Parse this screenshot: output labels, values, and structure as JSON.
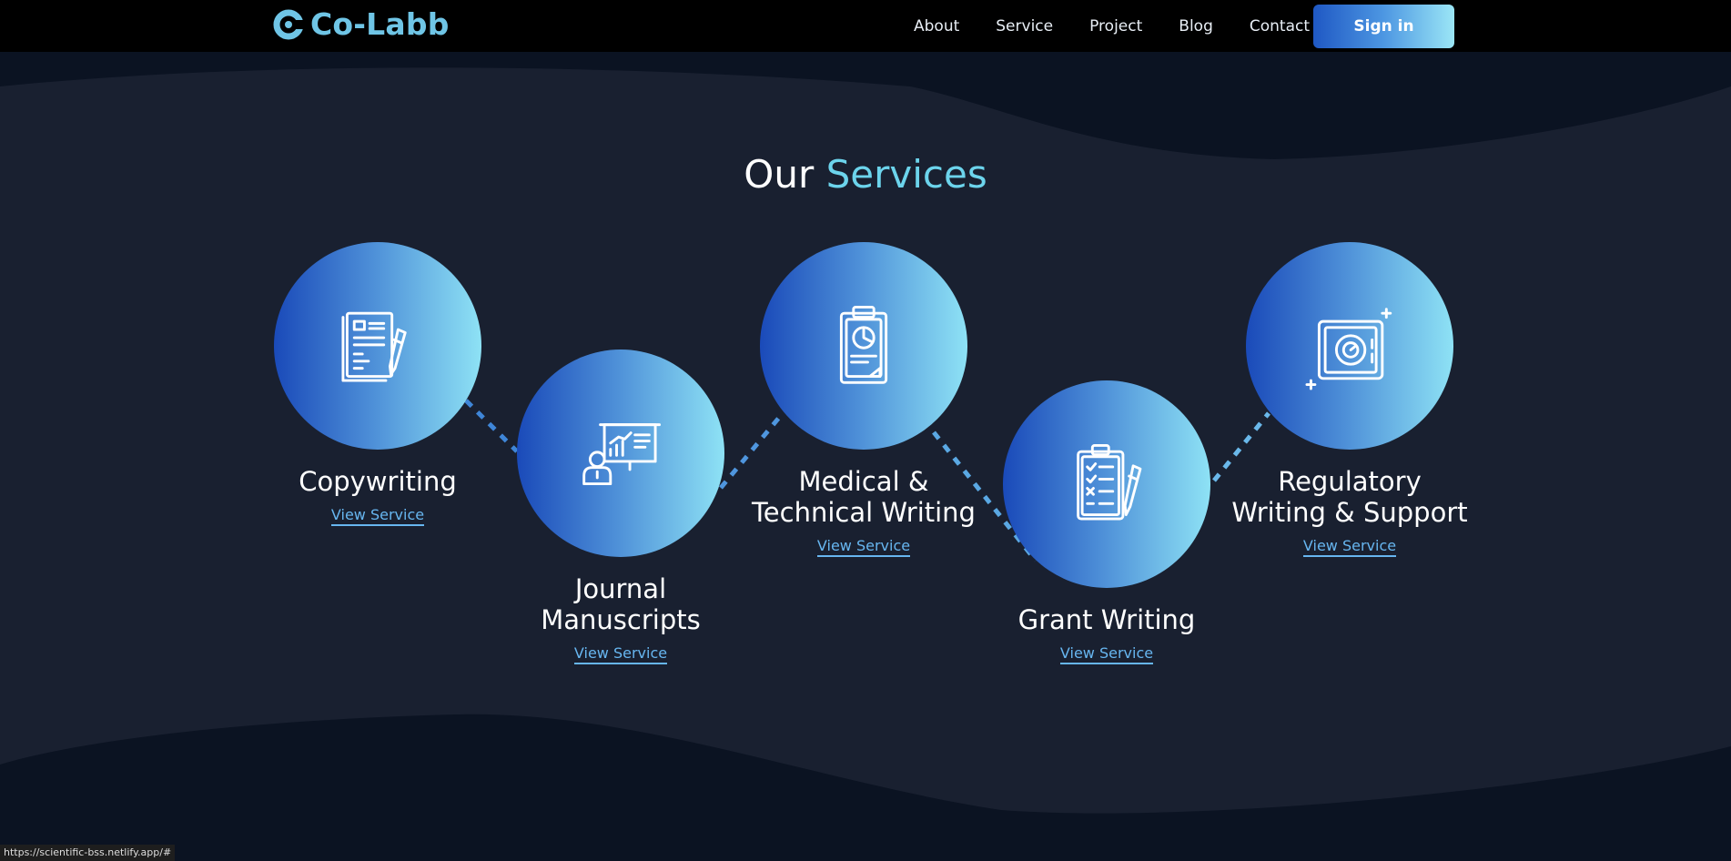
{
  "nav": {
    "logo_text": "Co-Labb",
    "links": [
      "About",
      "Service",
      "Project",
      "Blog",
      "Contact"
    ],
    "signin_label": "Sign in"
  },
  "section": {
    "heading_part1": "Our",
    "heading_part2": "Services"
  },
  "services": [
    {
      "title": "Copywriting",
      "link": "View Service",
      "icon": "document-pen-icon"
    },
    {
      "title": "Journal Manuscripts",
      "link": "View Service",
      "icon": "presentation-icon"
    },
    {
      "title": "Medical & Technical Writing",
      "link": "View Service",
      "icon": "clipboard-chart-icon"
    },
    {
      "title": "Grant Writing",
      "link": "View Service",
      "icon": "checklist-pen-icon"
    },
    {
      "title": "Regulatory Writing & Support",
      "link": "View Service",
      "icon": "safe-icon"
    }
  ],
  "status_bar": {
    "url": "https://scientific-bss.netlify.app/#"
  },
  "colors": {
    "background": "#0b1322",
    "wave_band": "#192030",
    "accent": "#6cd4ec",
    "link": "#67b6f0",
    "gradient_start": "#1a4ab9",
    "gradient_end": "#8ee2f5"
  }
}
